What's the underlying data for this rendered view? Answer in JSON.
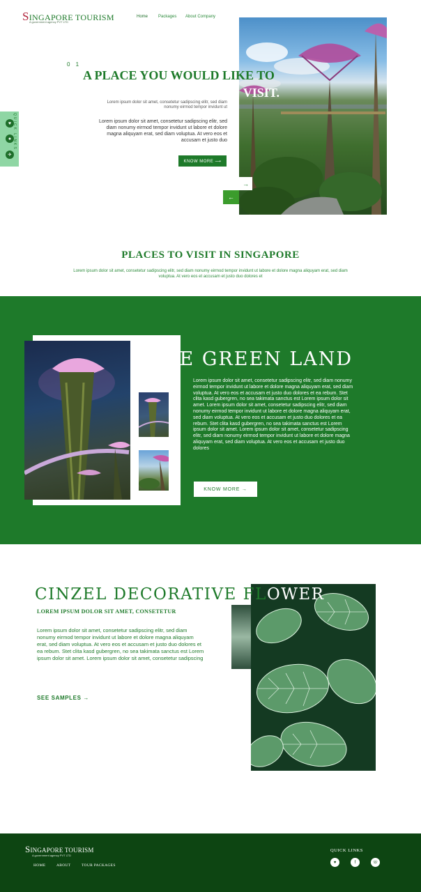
{
  "header": {
    "brand_cap": "S",
    "brand_rest": "INGAPORE TOURISM",
    "brand_sub": "A government agency PVT LTD",
    "nav": [
      "Home",
      "Packages",
      "About Company"
    ]
  },
  "hero": {
    "number": "0 1",
    "title_green": "A PLACE YOU WOULD LIKE TO",
    "title_white": "VISIT.",
    "para1": "Lorem ipsum dolor sit amet, consetetur sadipscing elitr, sed diam nonumy eirmod tempor invidunt ut",
    "para2": "Lorem ipsum dolor sit amet, consetetur sadipscing elitr, sed diam nonumy eirmod tempor invidunt ut labore et dolore magna aliquyam erat, sed diam voluptua. At vero eos et accusam et justo duo",
    "button": "KNOW MORE ⟶",
    "next_arrow": "→",
    "prev_arrow": "←"
  },
  "quick_links": {
    "label": "QUICK LINKS",
    "icons": [
      "heart-icon",
      "whatsapp-icon",
      "plane-icon"
    ]
  },
  "places": {
    "title": "PLACES TO VISIT IN SINGAPORE",
    "desc": "Lorem ipsum dolor sit amet, consetetur sadipscing elitr, sed diam nonumy eirmod tempor invidunt ut labore et dolore magna aliquyam erat, sed diam voluptua. At vero eos et accusam et justo duo dolores et"
  },
  "green_land": {
    "title": "THE GREEN LAND",
    "para": "Lorem ipsum dolor sit amet, consetetur sadipscing elitr, sed diam nonumy eirmod tempor invidunt ut labore et dolore magna aliquyam erat, sed diam voluptua. At vero eos et accusam et justo duo dolores et ea rebum. Stet clita kasd gubergren, no sea takimata sanctus est Lorem ipsum dolor sit amet. Lorem ipsum dolor sit amet, consetetur sadipscing elitr, sed diam nonumy eirmod tempor invidunt ut labore et dolore magna aliquyam erat, sed diam voluptua. At vero eos et accusam et justo duo dolores et ea rebum. Stet clita kasd gubergren, no sea takimata sanctus est Lorem ipsum dolor sit amet. Lorem ipsum dolor sit amet, consetetur sadipscing elitr, sed diam nonumy eirmod tempor invidunt ut labore et dolore magna aliquyam erat, sed diam voluptua. At vero eos et accusam et justo duo dolores",
    "button": "KNOW MORE →"
  },
  "flower": {
    "title_green": "CINZEL DECORATIVE FL",
    "title_white": "OWER",
    "subtitle": "LOREM IPSUM DOLOR SIT AMET, CONSETETUR",
    "para": "Lorem ipsum dolor sit amet, consetetur sadipscing elitr, sed diam nonumy eirmod tempor invidunt ut labore et dolore magna aliquyam erat, sed diam voluptua. At vero eos et accusam et justo duo dolores et ea rebum. Stet clita kasd gubergren, no sea takimata sanctus est Lorem ipsum dolor sit amet. Lorem ipsum dolor sit amet, consetetur sadipscing",
    "link": "SEE SAMPLES →"
  },
  "footer": {
    "brand_cap": "S",
    "brand_rest": "INGAPORE TOURISM",
    "brand_sub": "A government agency PVT LTD",
    "nav": [
      "HOME",
      "ABOUT",
      "TOUR PACKAGES"
    ],
    "quick_links": "QUICK LINKS",
    "icons": [
      "heart-icon",
      "facebook-icon",
      "phone-icon"
    ]
  },
  "colors": {
    "primary_green": "#1e7a2a",
    "footer_green": "#0d4512",
    "accent_red": "#b0213a",
    "side_panel": "#8fd6a4"
  }
}
